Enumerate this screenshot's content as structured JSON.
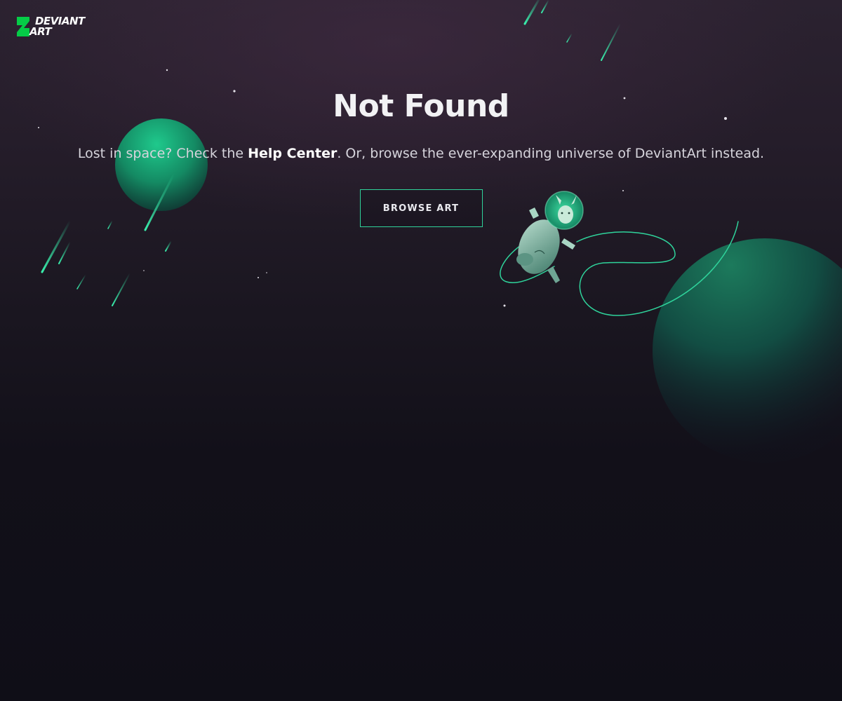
{
  "header": {
    "logo_line1": "DEVIANT",
    "logo_line2": "ART"
  },
  "main": {
    "title": "Not Found",
    "subtitle_before": "Lost in space? Check the ",
    "help_link_label": "Help Center",
    "subtitle_after": ". Or, browse the ever-expanding universe of DeviantArt instead.",
    "browse_button_label": "BROWSE ART"
  },
  "illustration": {
    "planets": [
      "small-planet",
      "large-planet"
    ],
    "character": "astronaut-llama",
    "decor": [
      "meteor-streaks",
      "stars",
      "tether-line"
    ]
  },
  "colors": {
    "accent": "#2fd39b",
    "background_top": "#2b2230",
    "background_bottom": "#0f0e17",
    "text_primary": "#f2f2f4",
    "text_secondary": "#d6d4dc"
  }
}
